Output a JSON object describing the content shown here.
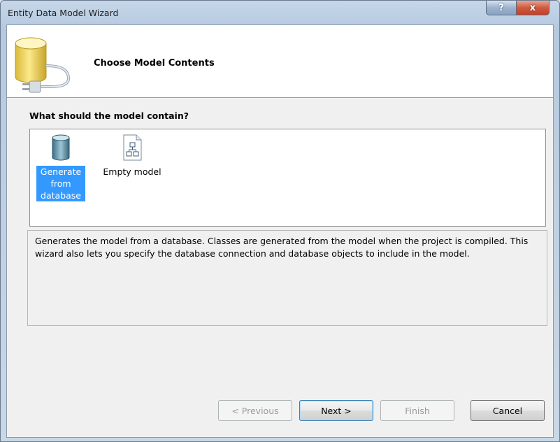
{
  "window": {
    "title": "Entity Data Model Wizard"
  },
  "titlebar": {
    "help_label": "?",
    "close_label": "x"
  },
  "header": {
    "title": "Choose Model Contents"
  },
  "main": {
    "question": "What should the model contain?",
    "options": [
      {
        "label": "Generate from database",
        "icon": "database-icon",
        "selected": true
      },
      {
        "label": "Empty model",
        "icon": "empty-model-icon",
        "selected": false
      }
    ],
    "description": "Generates the model from a database. Classes are generated from the model when the project is compiled. This wizard also lets you specify the database connection and database objects to include in the model."
  },
  "footer": {
    "previous_label": "< Previous",
    "next_label": "Next >",
    "finish_label": "Finish",
    "cancel_label": "Cancel"
  },
  "colors": {
    "selection": "#3399ff",
    "title_close": "#c7432c"
  }
}
